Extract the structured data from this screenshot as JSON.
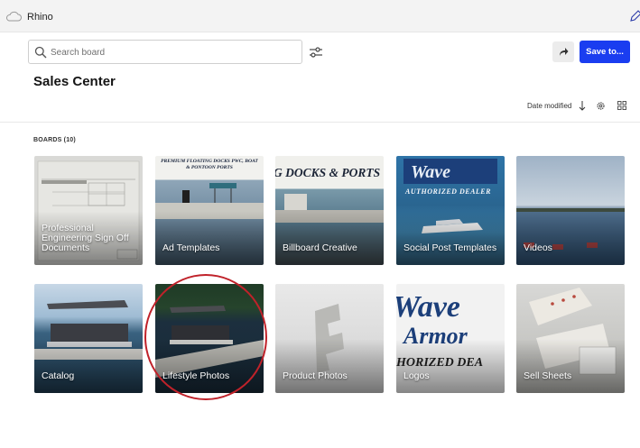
{
  "app": {
    "name": "Rhino"
  },
  "search": {
    "placeholder": "Search board"
  },
  "header": {
    "save_label": "Save to..."
  },
  "page": {
    "title": "Sales Center"
  },
  "sort": {
    "label": "Date modified"
  },
  "boards": {
    "heading": "BOARDS (10)",
    "items": [
      {
        "label": "Professional Engineering Sign Off Documents",
        "overlay": ""
      },
      {
        "label": "Ad Templates",
        "overlay": "PREMIUM FLOATING DOCKS PWC, BOAT & PONTOON PORTS"
      },
      {
        "label": "Billboard Creative",
        "overlay": "G DOCKS & PORTS"
      },
      {
        "label": "Social Post Templates",
        "overlay": "AUTHORIZED DEALER"
      },
      {
        "label": "Videos",
        "overlay": ""
      },
      {
        "label": "Catalog",
        "overlay": ""
      },
      {
        "label": "Lifestyle Photos",
        "overlay": ""
      },
      {
        "label": "Product Photos",
        "overlay": ""
      },
      {
        "label": "Logos",
        "overlay": "HORIZED DEA"
      },
      {
        "label": "Sell Sheets",
        "overlay": ""
      }
    ]
  },
  "colors": {
    "accent": "#1a3df0",
    "highlight": "#c0222a"
  }
}
